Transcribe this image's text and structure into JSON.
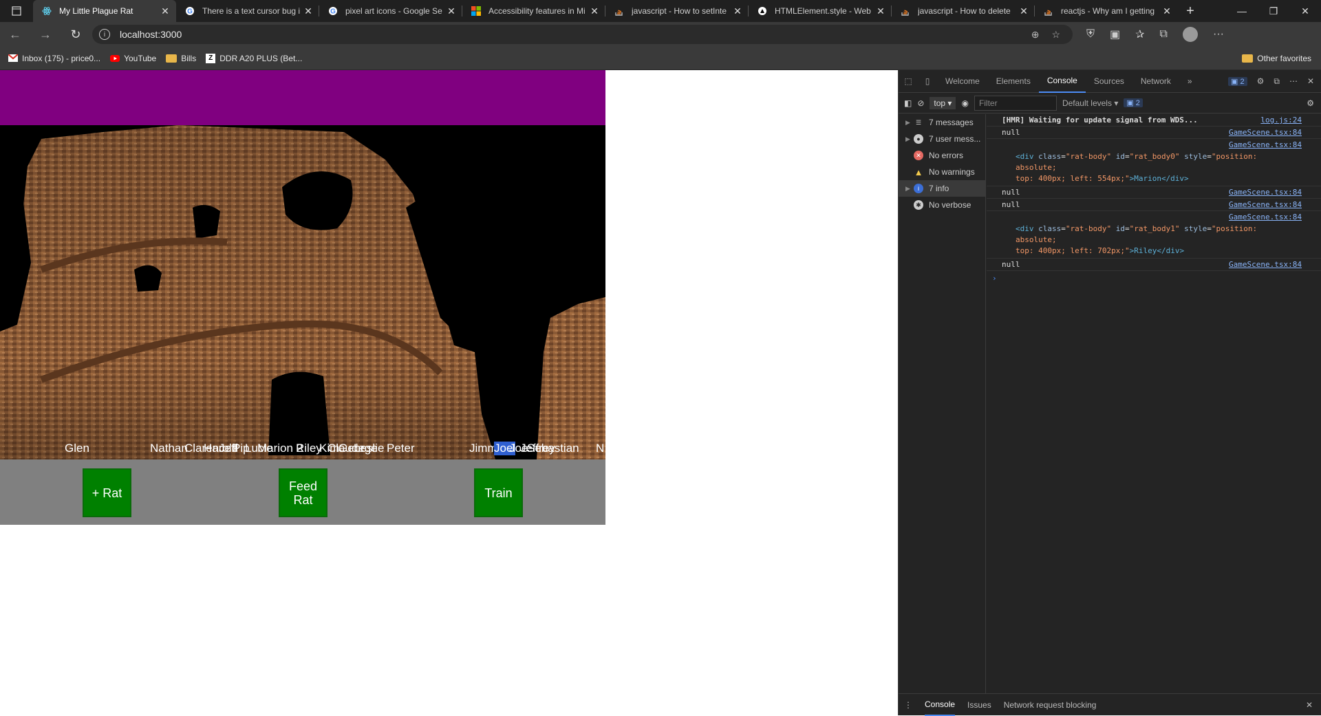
{
  "browser": {
    "tabs": [
      {
        "title": "My Little Plague Rat",
        "icon": "react-icon"
      },
      {
        "title": "There is a text cursor bug i",
        "icon": "google-icon"
      },
      {
        "title": "pixel art icons - Google Se",
        "icon": "google-icon"
      },
      {
        "title": "Accessibility features in Mi",
        "icon": "microsoft-icon"
      },
      {
        "title": "javascript - How to setInte",
        "icon": "stackoverflow-icon"
      },
      {
        "title": "HTMLElement.style - Web",
        "icon": "mdn-icon"
      },
      {
        "title": "javascript - How to delete",
        "icon": "stackoverflow-icon"
      },
      {
        "title": "reactjs - Why am I getting",
        "icon": "stackoverflow-icon"
      }
    ],
    "url": "localhost:3000",
    "bookmarks": [
      {
        "label": "Inbox (175) - price0...",
        "icon": "gmail-icon"
      },
      {
        "label": "YouTube",
        "icon": "youtube-icon"
      },
      {
        "label": "Bills",
        "icon": "folder-icon"
      },
      {
        "label": "DDR A20 PLUS (Bet...",
        "icon": "z-icon"
      }
    ],
    "other_favorites": "Other favorites"
  },
  "game": {
    "rat_names": [
      "Glen",
      "Nathan",
      "Clarence",
      "Harold",
      "Jeff",
      "Pip",
      "Lucie",
      "Marion 2",
      "Riley",
      "Kim",
      "Claude",
      "George",
      "Leslie",
      "Peter",
      "Jimmy",
      "Joel",
      "Joe",
      "Jeffrey",
      "Sebastian",
      "N"
    ],
    "buttons": {
      "add_rat": "+ Rat",
      "feed_rat": "Feed Rat",
      "train": "Train"
    },
    "colors": {
      "header": "#800080",
      "controls": "#808080",
      "button": "#008000"
    }
  },
  "devtools": {
    "tabs": [
      "Welcome",
      "Elements",
      "Console",
      "Sources",
      "Network"
    ],
    "active_tab": "Console",
    "issue_count": "2",
    "context": "top",
    "filter_placeholder": "Filter",
    "levels": "Default levels",
    "sidebar": [
      {
        "label": "7 messages",
        "icon": "list-icon"
      },
      {
        "label": "7 user mess...",
        "icon": "user-icon"
      },
      {
        "label": "No errors",
        "icon": "error-icon"
      },
      {
        "label": "No warnings",
        "icon": "warning-icon"
      },
      {
        "label": "7 info",
        "icon": "info-icon"
      },
      {
        "label": "No verbose",
        "icon": "bug-icon"
      }
    ],
    "logs": {
      "hmr": {
        "text": "[HMR] Waiting for update signal from WDS...",
        "src": "log.js:24"
      },
      "null1": {
        "text": "null",
        "src": "GameScene.tsx:84"
      },
      "div0": {
        "src": "GameScene.tsx:84",
        "open": "<div",
        "class_attr": "class",
        "class_val": "\"rat-body\"",
        "id_attr": "id",
        "id_val": "\"rat_body0\"",
        "style_attr": "style",
        "style_val": "\"position: absolute;",
        "style_cont": "top: 400px; left: 554px;\"",
        "content": ">Marion",
        "close": "</div>"
      },
      "null2": {
        "text": "null",
        "src": "GameScene.tsx:84"
      },
      "null3": {
        "text": "null",
        "src": "GameScene.tsx:84"
      },
      "div1": {
        "src": "GameScene.tsx:84",
        "open": "<div",
        "class_attr": "class",
        "class_val": "\"rat-body\"",
        "id_attr": "id",
        "id_val": "\"rat_body1\"",
        "style_attr": "style",
        "style_val": "\"position: absolute;",
        "style_cont": "top: 400px; left: 702px;\"",
        "content": ">Riley",
        "close": "</div>"
      },
      "null4": {
        "text": "null",
        "src": "GameScene.tsx:84"
      }
    },
    "drawer": {
      "console": "Console",
      "issues": "Issues",
      "network_blocking": "Network request blocking"
    }
  }
}
